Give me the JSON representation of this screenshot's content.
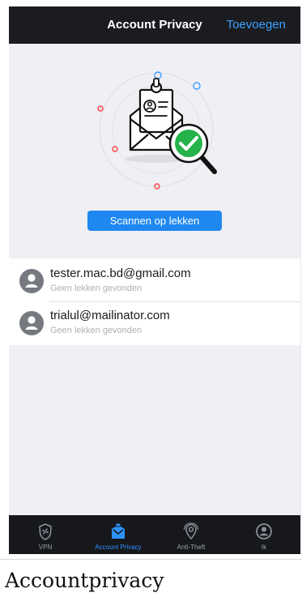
{
  "header": {
    "title": "Account Privacy",
    "action_label": "Toevoegen"
  },
  "hero": {
    "illustration_icon": "envelope-magnifier-check-icon",
    "scan_button_label": "Scannen op lekken"
  },
  "accounts": [
    {
      "email": "tester.mac.bd@gmail.com",
      "status": "Geen lekken gevonden",
      "icon": "user-avatar-icon"
    },
    {
      "email": "trialul@mailinator.com",
      "status": "Geen lekken gevonden",
      "icon": "user-avatar-icon"
    }
  ],
  "tabbar": {
    "items": [
      {
        "label": "VPN",
        "icon": "shield-icon",
        "active": false
      },
      {
        "label": "Account Privacy",
        "icon": "account-privacy-icon",
        "active": true
      },
      {
        "label": "Anti-Theft",
        "icon": "location-pin-icon",
        "active": false
      },
      {
        "label": "Ik",
        "icon": "profile-icon",
        "active": false
      }
    ]
  },
  "caption": "Accountprivacy",
  "colors": {
    "header_background": "#1b1c20",
    "accent_blue": "#1e88f0",
    "link_blue": "#3da0ff",
    "content_background": "#efeff4",
    "success_green": "#25b34a",
    "danger_red": "#ff4040"
  }
}
